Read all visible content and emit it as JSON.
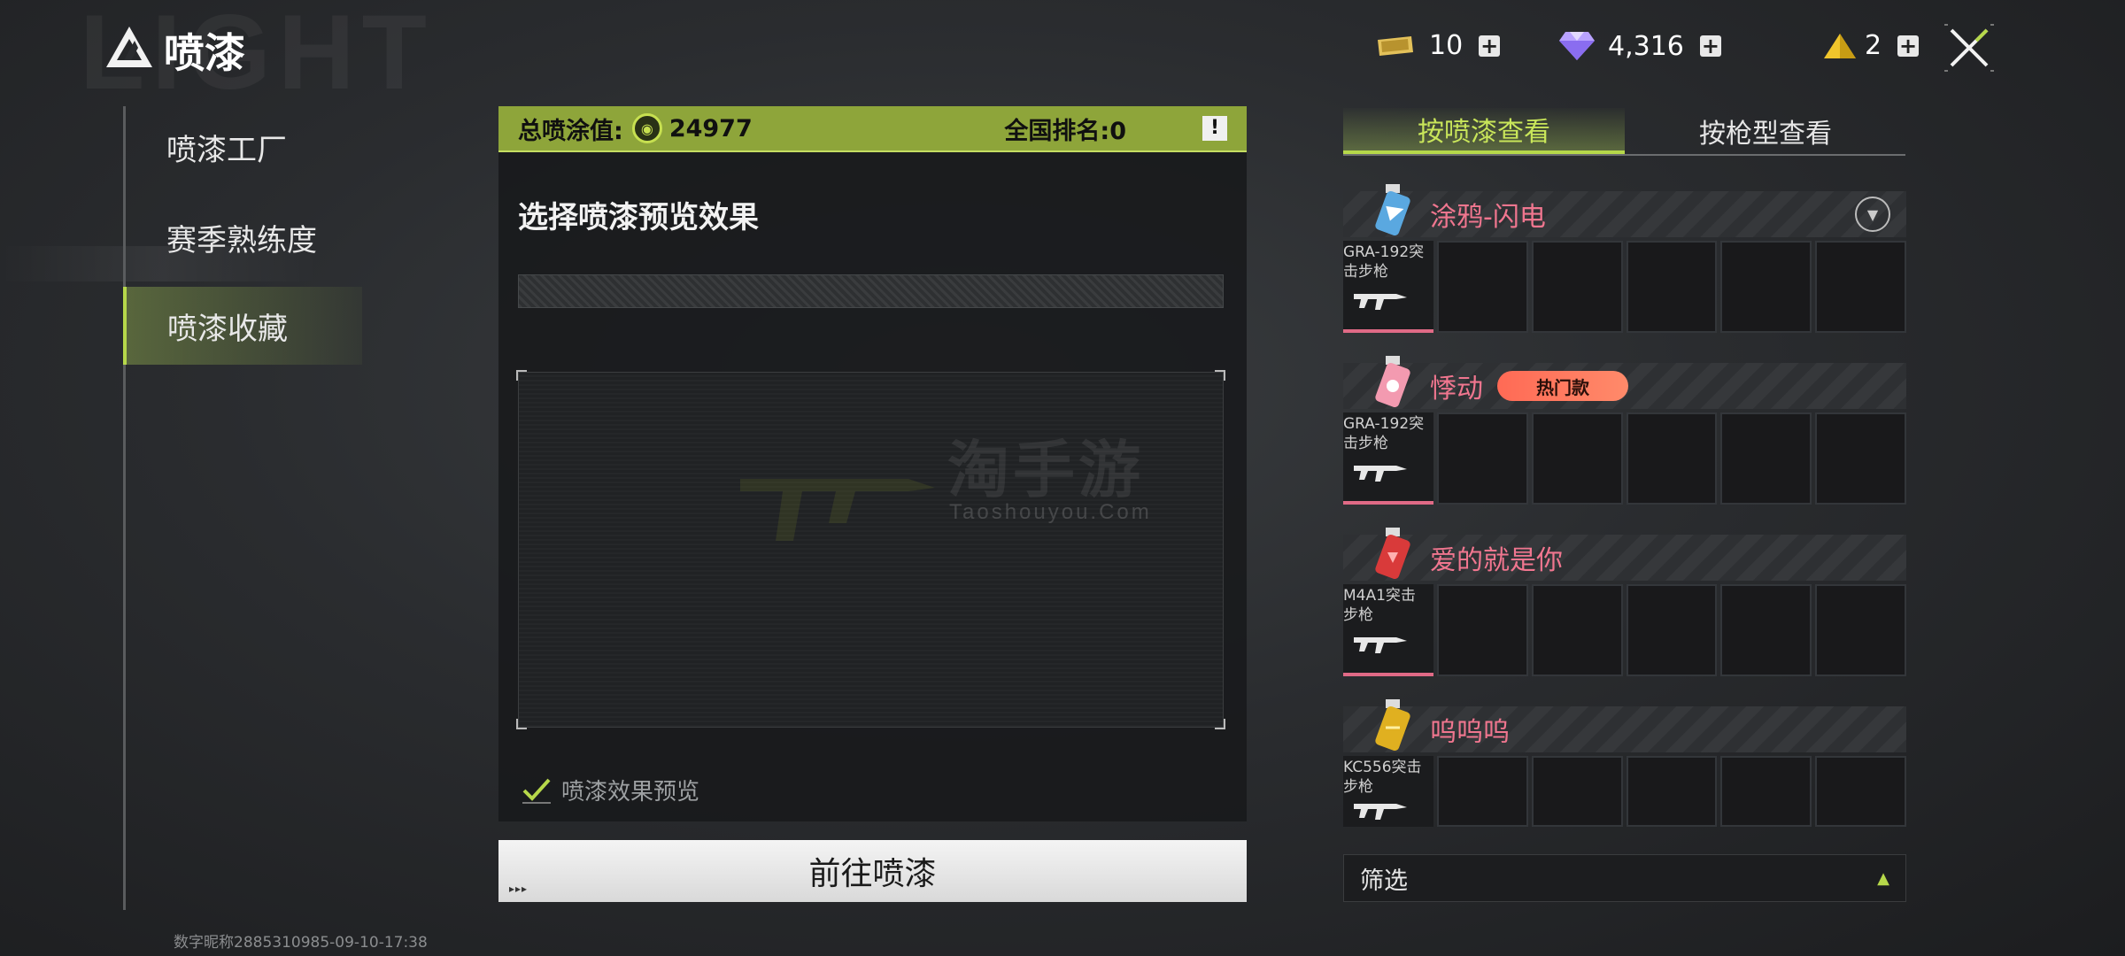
{
  "header": {
    "title": "喷漆",
    "bg_word": "LIGHT",
    "currencies": [
      {
        "icon": "ticket-icon",
        "value": "10"
      },
      {
        "icon": "diamond-icon",
        "value": "4,316"
      },
      {
        "icon": "pyramid-icon",
        "value": "2"
      }
    ]
  },
  "nav": {
    "items": [
      {
        "label": "喷漆工厂",
        "active": false
      },
      {
        "label": "赛季熟练度",
        "active": false
      },
      {
        "label": "喷漆收藏",
        "active": true
      }
    ],
    "footer": "数字昵称2885310985-09-10-17:38"
  },
  "center": {
    "score_label": "总喷涂值:",
    "score_value": "24977",
    "rank_label": "全国排名:0",
    "info_symbol": "!",
    "preview_title": "选择喷漆预览效果",
    "preview_checkbox_label": "喷漆效果预览",
    "preview_checked": true,
    "go_button": "前往喷漆",
    "go_dots": "▸▸▸"
  },
  "watermark": {
    "cn": "淘手游",
    "en": "Taoshouyou.Com"
  },
  "right": {
    "tabs": [
      {
        "label": "按喷漆查看",
        "active": true
      },
      {
        "label": "按枪型查看",
        "active": false
      }
    ],
    "sprays": [
      {
        "name": "涂鸦-闪电",
        "badge": "",
        "gun": "GRA-192突击步枪",
        "can_color": "#5aa8e0",
        "can_accent": "#ffffff"
      },
      {
        "name": "悸动",
        "badge": "热门款",
        "gun": "GRA-192突击步枪",
        "can_color": "#f39ab0",
        "can_accent": "#ffffff"
      },
      {
        "name": "爱的就是你",
        "badge": "",
        "gun": "M4A1突击步枪",
        "can_color": "#d93a3a",
        "can_accent": "#ffb0b0"
      },
      {
        "name": "呜呜呜",
        "badge": "",
        "gun": "KC556突击步枪",
        "can_color": "#e0b020",
        "can_accent": "#fff0a0"
      }
    ],
    "filter_label": "筛选"
  },
  "colors": {
    "accent": "#b6d84a",
    "pink": "#f0768f",
    "score_bar": "#8ea53a"
  }
}
